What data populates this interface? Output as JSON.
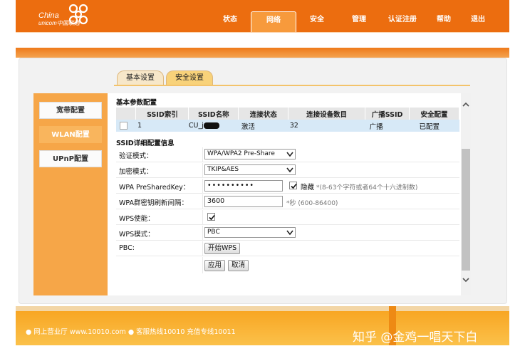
{
  "brand": {
    "line1": "China",
    "line2": "unicom中国联通"
  },
  "nav": [
    {
      "label": "状态",
      "width": 58,
      "active": false
    },
    {
      "label": "网络",
      "width": 64,
      "active": true
    },
    {
      "label": "安全",
      "width": 58,
      "active": false
    },
    {
      "label": "管理",
      "width": 60,
      "active": false
    },
    {
      "label": "认证注册",
      "width": 62,
      "active": false
    },
    {
      "label": "帮助",
      "width": 54,
      "active": false
    },
    {
      "label": "退出",
      "width": 42,
      "active": false
    }
  ],
  "tabs": [
    {
      "label": "基本设置"
    },
    {
      "label": "安全设置"
    }
  ],
  "sidebar": [
    {
      "label": "宽带配置"
    },
    {
      "label": "WLAN配置"
    },
    {
      "label": "UPnP配置"
    }
  ],
  "basic": {
    "title": "基本参数配置",
    "columns": [
      "",
      "SSID索引",
      "SSID名称",
      "连接状态",
      "连接设备数目",
      "广播SSID",
      "安全配置"
    ],
    "row": [
      "1",
      "CU_j",
      "激活",
      "32",
      "广播",
      "已配置"
    ]
  },
  "detail": {
    "title": "SSID详细配置信息",
    "auth_label": "验证模式：",
    "auth_value": "WPA/WPA2 Pre-Share",
    "enc_label": "加密模式：",
    "enc_value": "TKIP&AES",
    "psk_label": "WPA PreSharedKey：",
    "psk_value": "••••••••••",
    "hide_label": "隐藏",
    "psk_hint": "*(8-63个字符或者64个十六进制数)",
    "rekey_label": "WPA群密钥刷新间隔：",
    "rekey_value": "3600",
    "rekey_hint": "*秒 (600-86400)",
    "wps_enable_label": "WPS使能：",
    "wps_mode_label": "WPS模式：",
    "wps_mode_value": "PBC",
    "pbc_label": "PBC:",
    "pbc_button": "开始WPS",
    "apply_button": "应用",
    "cancel_button": "取消"
  },
  "footer": {
    "text": "● 网上营业厅  www.10010.com  ● 客服热线10010  充值专线10011"
  },
  "watermark": "知乎 @金鸡一唱天下白"
}
